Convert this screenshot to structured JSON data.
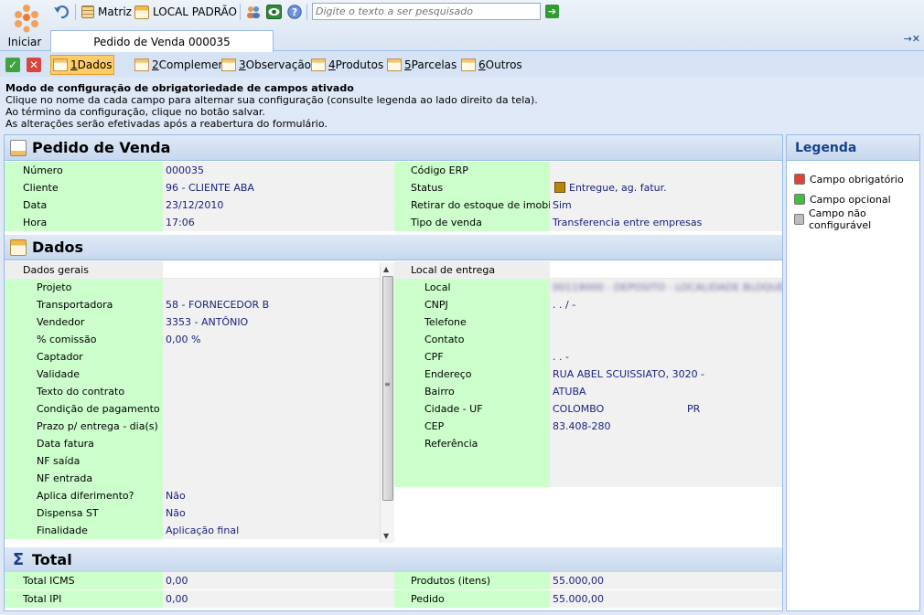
{
  "toolbar": {
    "start_label": "Iniciar",
    "matriz_label": "Matriz",
    "local_label": "LOCAL PADRÃO",
    "search_placeholder": "Digite o texto a ser pesquisado",
    "go_icon": "arrow-right-icon"
  },
  "tab": {
    "title": "Pedido de Venda 000035"
  },
  "subtabs": [
    {
      "num": "1",
      "label": " Dados"
    },
    {
      "num": "2",
      "label": " Complemento"
    },
    {
      "num": "3",
      "label": " Observação"
    },
    {
      "num": "4",
      "label": " Produtos"
    },
    {
      "num": "5",
      "label": " Parcelas"
    },
    {
      "num": "6",
      "label": " Outros"
    }
  ],
  "notice": {
    "title": "Modo de configuração de obrigatoriedade de campos ativado",
    "lines": [
      "Clique no nome da cada campo para alternar sua configuração (consulte legenda ao lado direito da tela).",
      "Ao término da configuração, clique no botão salvar.",
      "As alterações serão efetivadas após a reabertura do formulário."
    ]
  },
  "pedido": {
    "title": "Pedido de Venda",
    "left": [
      {
        "label": "Número",
        "value": "000035"
      },
      {
        "label": "Cliente",
        "value": "96 - CLIENTE ABA"
      },
      {
        "label": "Data",
        "value": "23/12/2010"
      },
      {
        "label": "Hora",
        "value": "17:06"
      }
    ],
    "right": [
      {
        "label": "Código ERP",
        "value": ""
      },
      {
        "label": "Status",
        "value": "Entregue, ag. fatur."
      },
      {
        "label": "Retirar do estoque de imobilizado",
        "value": "Sim"
      },
      {
        "label": "Tipo de venda",
        "value": "Transferencia entre empresas"
      }
    ]
  },
  "dados": {
    "title": "Dados",
    "group_left": "Dados gerais",
    "left": [
      {
        "label": "Projeto",
        "value": ""
      },
      {
        "label": "Transportadora",
        "value": "58 - FORNECEDOR B"
      },
      {
        "label": "Vendedor",
        "value": "3353 - ANTÔNIO"
      },
      {
        "label": "% comissão",
        "value": " 0,00 %"
      },
      {
        "label": "Captador",
        "value": ""
      },
      {
        "label": "Validade",
        "value": ""
      },
      {
        "label": "Texto do contrato",
        "value": ""
      },
      {
        "label": "Condição de pagamento",
        "value": ""
      },
      {
        "label": "Prazo p/ entrega - dia(s)",
        "value": ""
      },
      {
        "label": "Data fatura",
        "value": ""
      },
      {
        "label": "NF saída",
        "value": ""
      },
      {
        "label": "NF entrada",
        "value": ""
      },
      {
        "label": "Aplica diferimento?",
        "value": "Não"
      },
      {
        "label": "Dispensa ST",
        "value": "Não"
      },
      {
        "label": "Finalidade",
        "value": "Aplicação final"
      }
    ],
    "group_right": "Local de entrega",
    "right": [
      {
        "label": "Local",
        "value": "00119000 - DEPOSITO - LOCALIDADE BLOQUEADA"
      },
      {
        "label": "CNPJ",
        "value": "  .   .   /    -"
      },
      {
        "label": "Telefone",
        "value": ""
      },
      {
        "label": "Contato",
        "value": ""
      },
      {
        "label": "CPF",
        "value": "  .   .   -"
      },
      {
        "label": "Endereço",
        "value": "RUA ABEL SCUISSIATO, 3020 -"
      },
      {
        "label": "Bairro",
        "value": "ATUBA"
      },
      {
        "label": "Cidade - UF",
        "value": "COLOMBO",
        "uf": "PR"
      },
      {
        "label": "CEP",
        "value": "83.408-280"
      },
      {
        "label": "Referência",
        "value": ""
      }
    ]
  },
  "total": {
    "title": "Total",
    "left": [
      {
        "label": "Total ICMS",
        "value": "0,00"
      },
      {
        "label": "Total IPI",
        "value": "0,00"
      }
    ],
    "right": [
      {
        "label": "Produtos (itens)",
        "value": "55.000,00"
      },
      {
        "label": "Pedido",
        "value": "55.000,00"
      }
    ]
  },
  "legend": {
    "title": "Legenda",
    "items": [
      {
        "label": "Campo obrigatório",
        "color": "#e8402f"
      },
      {
        "label": "Campo opcional",
        "color": "#3fbf3f"
      },
      {
        "label": "Campo não configurável",
        "color": "#bdbdbd"
      }
    ]
  }
}
